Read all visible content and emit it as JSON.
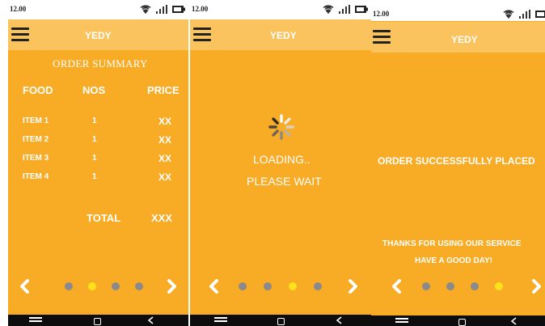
{
  "colors": {
    "background": "#f8ab25",
    "app_bar": "#fac35e",
    "dot_inactive": "#8a8a8a",
    "dot_active": "#ffe21a",
    "text": "#ffffff"
  },
  "status_bar": {
    "time": "12.00"
  },
  "app": {
    "title": "YEDY"
  },
  "screen1": {
    "heading": "ORDER SUMMARY",
    "columns": [
      "FOOD",
      "NOS",
      "PRICE"
    ],
    "rows": [
      {
        "food": "ITEM 1",
        "nos": "1",
        "price": "XX"
      },
      {
        "food": "ITEM 2",
        "nos": "1",
        "price": "XX"
      },
      {
        "food": "ITEM 3",
        "nos": "1",
        "price": "XX"
      },
      {
        "food": "ITEM 4",
        "nos": "1",
        "price": "XX"
      }
    ],
    "total_label": "TOTAL",
    "total_value": "XXX",
    "pager": {
      "page_count": 4,
      "active_index": 1
    }
  },
  "screen2": {
    "loading_text": "LOADING..",
    "wait_text": "PLEASE WAIT",
    "pager": {
      "page_count": 4,
      "active_index": 2
    }
  },
  "screen3": {
    "message": "ORDER SUCCESSFULLY PLACED",
    "thanks_line1": "THANKS FOR USING OUR SERVICE",
    "thanks_line2": "HAVE A GOOD DAY!",
    "pager": {
      "page_count": 4,
      "active_index": 3
    }
  },
  "icons": {
    "menu": "hamburger-menu-icon",
    "wifi": "wifi-icon",
    "signal": "signal-icon",
    "battery": "battery-icon",
    "spinner": "spinner-icon",
    "prev": "chevron-left-icon",
    "next": "chevron-right-icon",
    "sys_menu": "menu-lines-icon",
    "sys_home": "home-square-icon",
    "sys_back": "back-chevron-icon"
  }
}
